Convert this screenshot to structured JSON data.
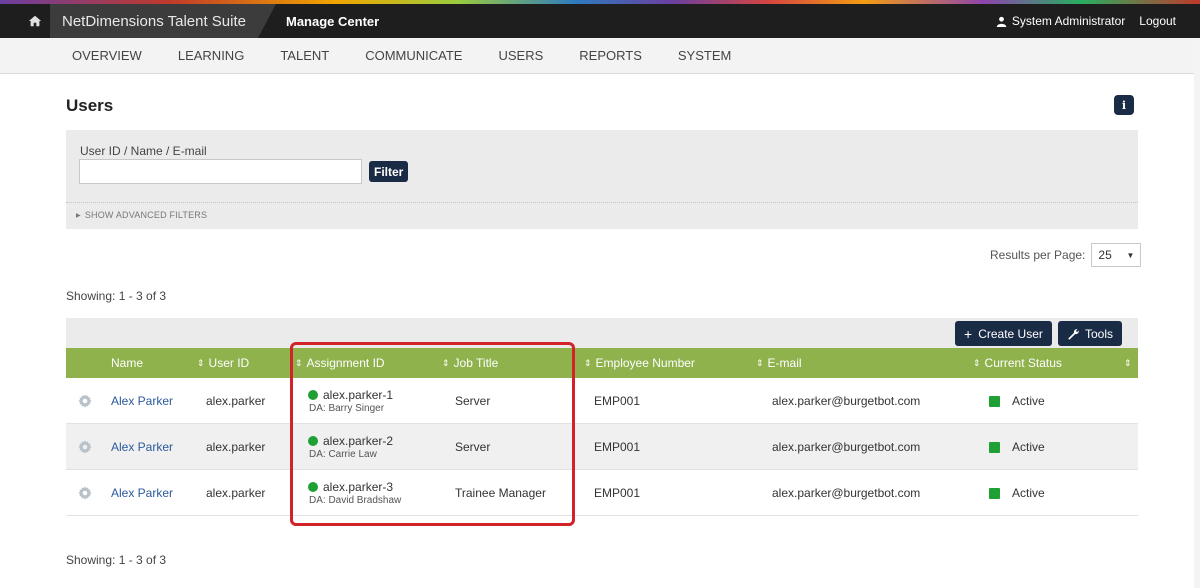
{
  "topbar": {
    "brand": "NetDimensions Talent Suite",
    "section": "Manage Center",
    "user_name": "System Administrator",
    "logout_label": "Logout"
  },
  "nav": [
    "OVERVIEW",
    "LEARNING",
    "TALENT",
    "COMMUNICATE",
    "USERS",
    "REPORTS",
    "SYSTEM"
  ],
  "page": {
    "title": "Users",
    "info_icon": "i"
  },
  "filter": {
    "label": "User ID / Name / E-mail",
    "value": "",
    "button_label": "Filter",
    "advanced_label": "SHOW ADVANCED FILTERS"
  },
  "results_per_page": {
    "label": "Results per Page:",
    "value": "25"
  },
  "showing": "Showing: 1 - 3 of 3",
  "toolbar": {
    "create_label": "Create User",
    "tools_label": "Tools"
  },
  "table": {
    "headers": {
      "name": "Name",
      "user_id": "User ID",
      "assignment_id": "Assignment ID",
      "job_title": "Job Title",
      "employee_number": "Employee Number",
      "email": "E-mail",
      "status": "Current Status"
    },
    "rows": [
      {
        "name": "Alex Parker",
        "user_id": "alex.parker",
        "assignment_id": "alex.parker-1",
        "da": "DA: Barry Singer",
        "job_title": "Server",
        "employee_number": "EMP001",
        "email": "alex.parker@burgetbot.com",
        "status": "Active"
      },
      {
        "name": "Alex Parker",
        "user_id": "alex.parker",
        "assignment_id": "alex.parker-2",
        "da": "DA: Carrie Law",
        "job_title": "Server",
        "employee_number": "EMP001",
        "email": "alex.parker@burgetbot.com",
        "status": "Active"
      },
      {
        "name": "Alex Parker",
        "user_id": "alex.parker",
        "assignment_id": "alex.parker-3",
        "da": "DA: David Bradshaw",
        "job_title": "Trainee Manager",
        "employee_number": "EMP001",
        "email": "alex.parker@burgetbot.com",
        "status": "Active"
      }
    ]
  },
  "colors": {
    "header_green": "#8fb24d",
    "dark_navy": "#1a2b45",
    "status_green": "#1ea035",
    "highlight_red": "#d2232a",
    "link_blue": "#2a5a9c"
  }
}
